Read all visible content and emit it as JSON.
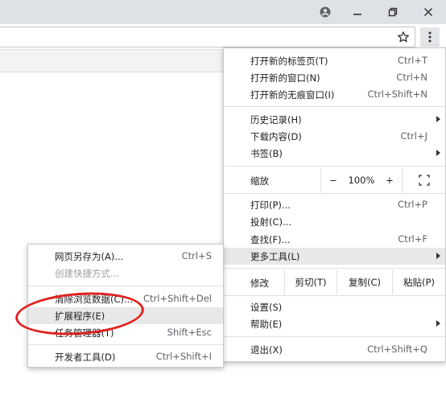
{
  "window": {
    "account_icon": "account-circle-icon",
    "minimize_icon": "minimize-icon",
    "restore_icon": "restore-icon",
    "close_icon": "close-icon"
  },
  "toolbar": {
    "bookmark_icon": "star-icon",
    "menu_icon": "kebab-menu-icon"
  },
  "menu": {
    "new_tab": {
      "label": "打开新的标签页(T)",
      "shortcut": "Ctrl+T"
    },
    "new_window": {
      "label": "打开新的窗口(N)",
      "shortcut": "Ctrl+N"
    },
    "new_incognito": {
      "label": "打开新的无痕窗口(I)",
      "shortcut": "Ctrl+Shift+N"
    },
    "history": {
      "label": "历史记录(H)"
    },
    "downloads": {
      "label": "下载内容(D)",
      "shortcut": "Ctrl+J"
    },
    "bookmarks": {
      "label": "书签(B)"
    },
    "zoom": {
      "label": "缩放",
      "minus": "−",
      "value": "100%",
      "plus": "+",
      "fullscreen_icon": "fullscreen-icon"
    },
    "print": {
      "label": "打印(P)...",
      "shortcut": "Ctrl+P"
    },
    "cast": {
      "label": "投射(C)..."
    },
    "find": {
      "label": "查找(F)...",
      "shortcut": "Ctrl+F"
    },
    "more_tools": {
      "label": "更多工具(L)"
    },
    "edit": {
      "label": "修改",
      "cut": "剪切(T)",
      "copy": "复制(C)",
      "paste": "粘贴(P)"
    },
    "settings": {
      "label": "设置(S)"
    },
    "help": {
      "label": "帮助(E)"
    },
    "exit": {
      "label": "退出(X)",
      "shortcut": "Ctrl+Shift+Q"
    }
  },
  "submenu": {
    "save_page": {
      "label": "网页另存为(A)...",
      "shortcut": "Ctrl+S"
    },
    "create_shortcut": {
      "label": "创建快捷方式..."
    },
    "clear_data": {
      "label": "清除浏览数据(C)...",
      "shortcut": "Ctrl+Shift+Del"
    },
    "extensions": {
      "label": "扩展程序(E)"
    },
    "task_manager": {
      "label": "任务管理器(T)",
      "shortcut": "Shift+Esc"
    },
    "dev_tools": {
      "label": "开发者工具(D)",
      "shortcut": "Ctrl+Shift+I"
    }
  },
  "annotation": {
    "color": "#e0211f"
  }
}
